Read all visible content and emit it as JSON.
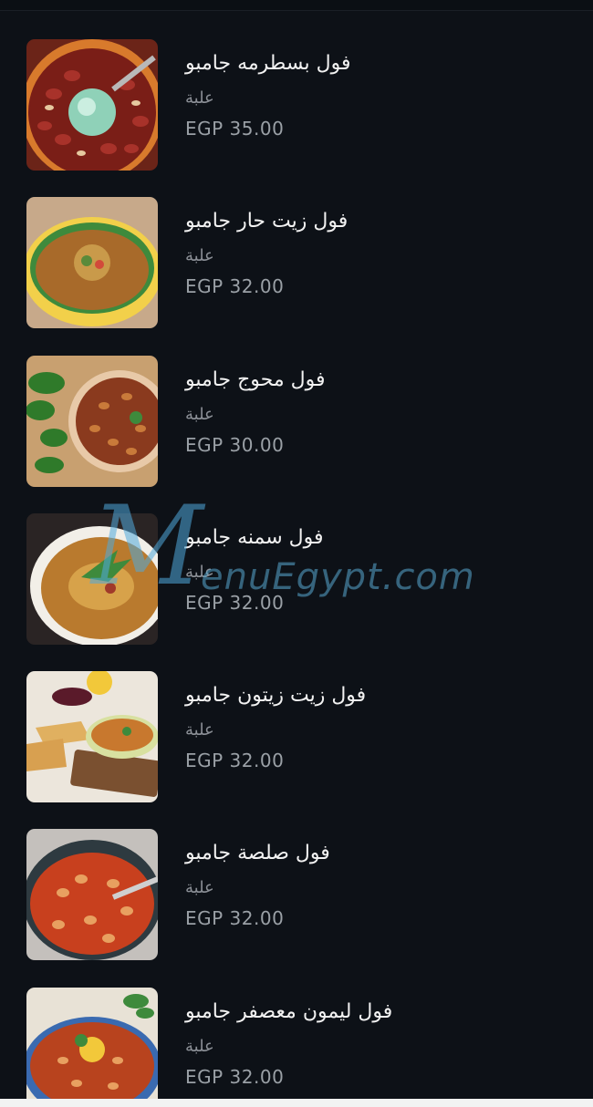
{
  "items": [
    {
      "name": "فول بسطرمه جامبو",
      "unit": "علبة",
      "price": "EGP 35.00",
      "image": "bowl-fava-pastrami"
    },
    {
      "name": "فول زيت حار جامبو",
      "unit": "علبة",
      "price": "EGP 32.00",
      "image": "bowl-fava-hot-oil"
    },
    {
      "name": "فول محوج جامبو",
      "unit": "علبة",
      "price": "EGP 30.00",
      "image": "bowl-fava-spiced"
    },
    {
      "name": "فول سمنه جامبو",
      "unit": "علبة",
      "price": "EGP 32.00",
      "image": "bowl-fava-ghee"
    },
    {
      "name": "فول زيت زيتون جامبو",
      "unit": "علبة",
      "price": "EGP 32.00",
      "image": "bowl-fava-olive-oil"
    },
    {
      "name": "فول صلصة جامبو",
      "unit": "علبة",
      "price": "EGP 32.00",
      "image": "bowl-fava-tomato"
    },
    {
      "name": "فول ليمون معصفر جامبو",
      "unit": "علبة",
      "price": "EGP 32.00",
      "image": "bowl-fava-lemon"
    }
  ],
  "watermark": {
    "letter": "M",
    "text": "enuEgypt.com"
  },
  "colors": {
    "background": "#0d1117",
    "title": "#f2f2f2",
    "muted": "#8b8f96"
  }
}
